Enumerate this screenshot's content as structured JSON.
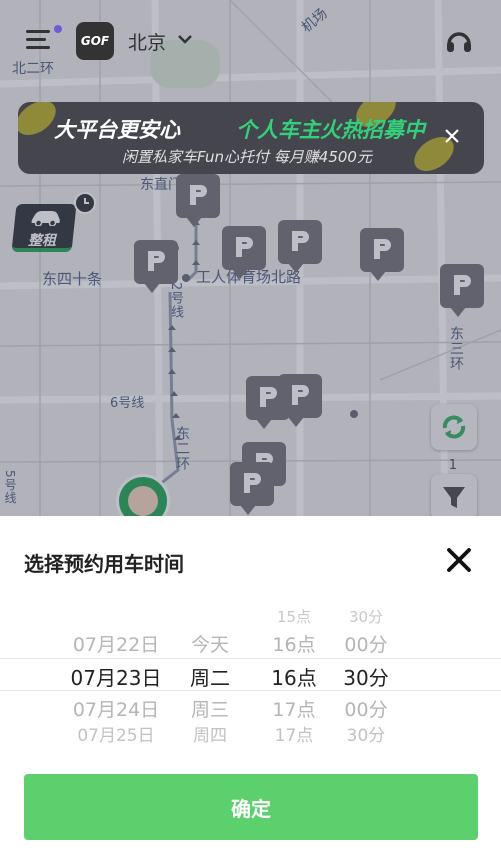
{
  "header": {
    "logo_text": "GOF",
    "city": "北京",
    "menu_icon": "menu-icon",
    "support_icon": "headset-icon"
  },
  "banner": {
    "title_white": "大平台更安心",
    "title_green": "个人车主火热招募中",
    "subtitle": "闲置私家车Fun心托付 每月赚4500元",
    "close_icon": "close-icon"
  },
  "map": {
    "labels": {
      "beierhuan": "北二环",
      "jichang": "机场",
      "dongzhimen": "东直门",
      "dongsishitiao": "东四十条",
      "gongren_tiyuchang_beilu": "工人体育场北路",
      "line2": "2号线",
      "dongsanhuan": "东三环",
      "line6": "6号线",
      "dongerhuan": "东二环",
      "line5": "5号线"
    },
    "zhengzu_label": "整租",
    "filter_count": "1"
  },
  "sheet": {
    "title": "选择预约用车时间",
    "close_icon": "close-icon",
    "picker": {
      "dates": [
        "07月22日",
        "07月23日",
        "07月24日",
        "07月25日"
      ],
      "weekdays": [
        "今天",
        "周二",
        "周三",
        "周四"
      ],
      "hours": [
        "15点",
        "16点",
        "16点",
        "17点",
        "17点"
      ],
      "minutes": [
        "30分",
        "00分",
        "30分",
        "00分",
        "30分"
      ],
      "selected": {
        "date": "07月23日",
        "weekday": "周二",
        "hour": "16点",
        "minute": "30分"
      }
    },
    "confirm_label": "确定"
  },
  "colors": {
    "accent_green": "#5bd06d",
    "banner_bg": "#45454d",
    "pin_gray": "#7b7b82"
  }
}
